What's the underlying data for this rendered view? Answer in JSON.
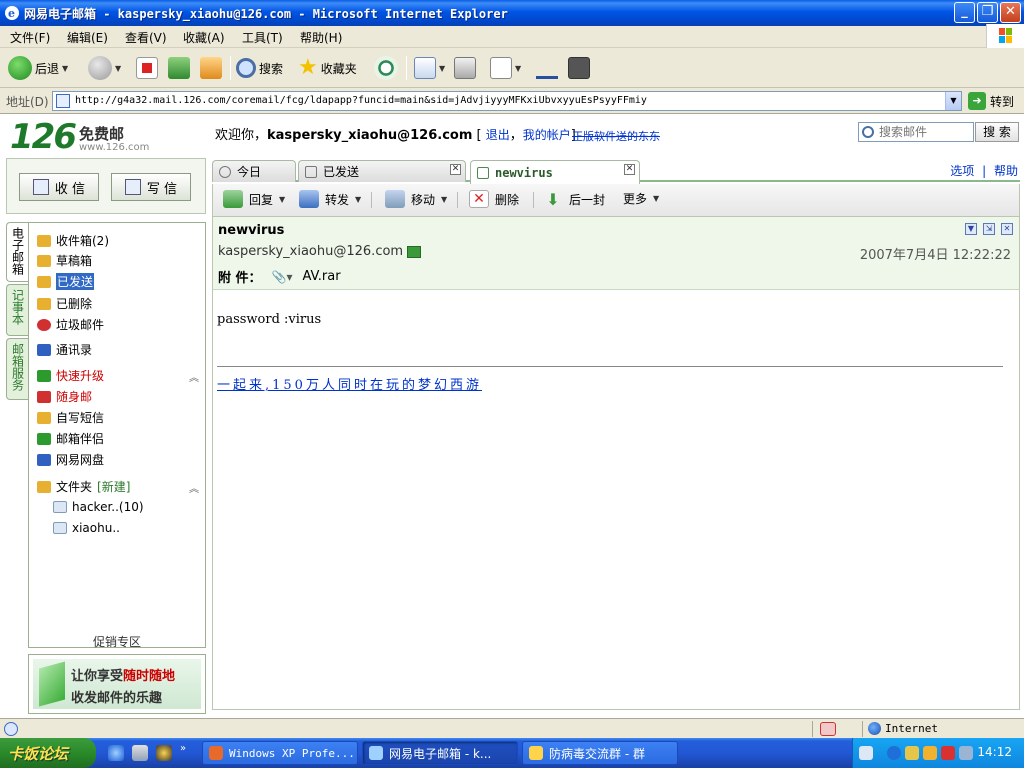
{
  "window": {
    "title": "网易电子邮箱 - kaspersky_xiaohu@126.com - Microsoft Internet Explorer",
    "min": "_",
    "max": "❐",
    "close": "✕"
  },
  "menu": [
    "文件(F)",
    "编辑(E)",
    "查看(V)",
    "收藏(A)",
    "工具(T)",
    "帮助(H)"
  ],
  "toolbar": {
    "back": "后退",
    "search": "搜索",
    "favorites": "收藏夹"
  },
  "address": {
    "label": "地址(D)",
    "url": "http://g4a32.mail.126.com/coremail/fcg/ldapapp?funcid=main&sid=jAdvjiyyyMFKxiUbvxyyuEsPsyyFFmiy",
    "go": "转到"
  },
  "logo": {
    "number": "126",
    "free": "免费邮",
    "site": "www.126.com"
  },
  "header": {
    "welcome": "欢迎你，",
    "user": "kaspersky_xiaohu@126.com",
    "bracket_open": " [ ",
    "logout": "退出",
    "comma": "，",
    "account": "我的帐户",
    "bracket_close": "]",
    "promo": "正版软件送的东东",
    "search_placeholder": "搜索邮件",
    "search_button": "搜 索"
  },
  "actions": {
    "receive": "收 信",
    "write": "写 信"
  },
  "side_tabs": [
    "电子邮箱",
    "记事本",
    "邮箱服务"
  ],
  "folders": [
    {
      "label": "收件箱(2)",
      "color": "#e8b030"
    },
    {
      "label": "草稿箱",
      "color": "#e8b030"
    },
    {
      "label": "已发送",
      "color": "#e8b030"
    },
    {
      "label": "已删除",
      "color": "#e8b030"
    },
    {
      "label": "垃圾邮件",
      "color": "#d03030"
    },
    {
      "label": "通讯录",
      "color": "#3060c0"
    }
  ],
  "services": [
    {
      "label": "快速升级",
      "red": true,
      "color": "#2d9a2d"
    },
    {
      "label": "随身邮",
      "red": true,
      "color": "#d03030"
    },
    {
      "label": "自写短信",
      "red": false,
      "color": "#e8b030"
    },
    {
      "label": "邮箱伴侣",
      "red": false,
      "color": "#2d9a2d"
    },
    {
      "label": "网易网盘",
      "red": false,
      "color": "#3060c0"
    }
  ],
  "folder_section": {
    "label": "文件夹",
    "new": "[新建]"
  },
  "user_folders": [
    "hacker..(10)",
    "xiaohu.."
  ],
  "promo_zone": "促销专区",
  "ad": {
    "line1_a": "让你享受",
    "line1_b": "随时随地",
    "line2": "收发邮件的乐趣"
  },
  "tabs": [
    {
      "label": "今日"
    },
    {
      "label": "已发送"
    },
    {
      "label": "newvirus"
    }
  ],
  "top_links": {
    "options": "选项",
    "sep": "|",
    "help": "帮助"
  },
  "mail_toolbar": {
    "reply": "回复",
    "forward": "转发",
    "move": "移动",
    "delete": "删除",
    "next": "后一封",
    "more": "更多"
  },
  "mail": {
    "subject": "newvirus",
    "from": "kaspersky_xiaohu@126.com",
    "date": "2007年7月4日 12:22:22",
    "attach_label": "附 件：",
    "attachment": "AV.rar",
    "body": "password :virus",
    "footer_ad": "一起来,150万人同时在玩的梦幻西游"
  },
  "status": {
    "zone": "Internet"
  },
  "taskbar": {
    "start": "卡饭论坛",
    "tasks": [
      "Windows XP Profe...",
      "网易电子邮箱 - k...",
      "防病毒交流群 - 群"
    ],
    "clock": "14:12"
  }
}
